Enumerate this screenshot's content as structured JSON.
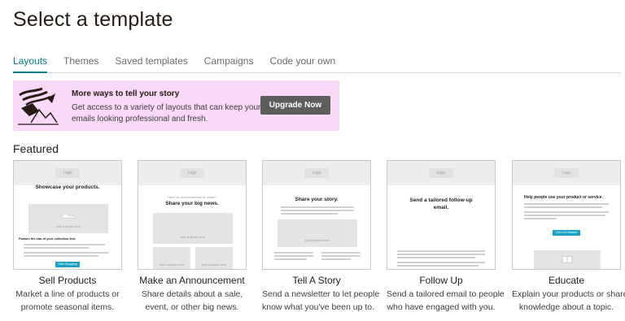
{
  "page": {
    "title": "Select a template"
  },
  "tabs": [
    {
      "label": "Layouts",
      "active": true
    },
    {
      "label": "Themes",
      "active": false
    },
    {
      "label": "Saved templates",
      "active": false
    },
    {
      "label": "Campaigns",
      "active": false
    },
    {
      "label": "Code your own",
      "active": false
    }
  ],
  "banner": {
    "title": "More ways to tell your story",
    "text": "Get access to a variety of layouts that can keep your emails looking professional and fresh.",
    "button_label": "Upgrade Now",
    "background_color": "#f8d9f8"
  },
  "featured": {
    "label": "Featured",
    "cards": [
      {
        "title": "Sell Products",
        "desc_line1": "Market a line of products or",
        "desc_line2": "promote seasonal items.",
        "preview": {
          "logo": "Logo",
          "headline": "Showcase your products.",
          "photo": "Add a photo here",
          "feature": "Feature the star of your collection first.",
          "button": "Start Shopping"
        }
      },
      {
        "title": "Make an Announcement",
        "desc_line1": "Share details about a sale,",
        "desc_line2": "event, or other big news.",
        "preview": {
          "logo": "Logo",
          "kicker": "Have an announcement to make?",
          "headline": "Share your big news.",
          "photo": "Add a photo here",
          "photo2": "Add a photo here",
          "photo3": "Add a photo here"
        }
      },
      {
        "title": "Tell A Story",
        "desc_line1": "Send a newsletter to let people",
        "desc_line2": "know what you've been up to.",
        "preview": {
          "logo": "Logo",
          "headline": "Share your story.",
          "photo": "Add a photo here"
        }
      },
      {
        "title": "Follow Up",
        "desc_line1": "Send a tailored email to people",
        "desc_line2": "who have engaged with you.",
        "preview": {
          "logo": "Logo",
          "headline": "Send a tailored follow-up email."
        }
      },
      {
        "title": "Educate",
        "desc_line1": "Explain your products or share",
        "desc_line2": "knowledge about a topic.",
        "preview": {
          "logo": "Logo",
          "headline": "Help people use your product or service.",
          "button": "Let's Get Started"
        }
      }
    ]
  },
  "colors": {
    "accent": "#007c89",
    "button_dark": "#5d5d5d",
    "mini_button": "#1aa3c5"
  }
}
